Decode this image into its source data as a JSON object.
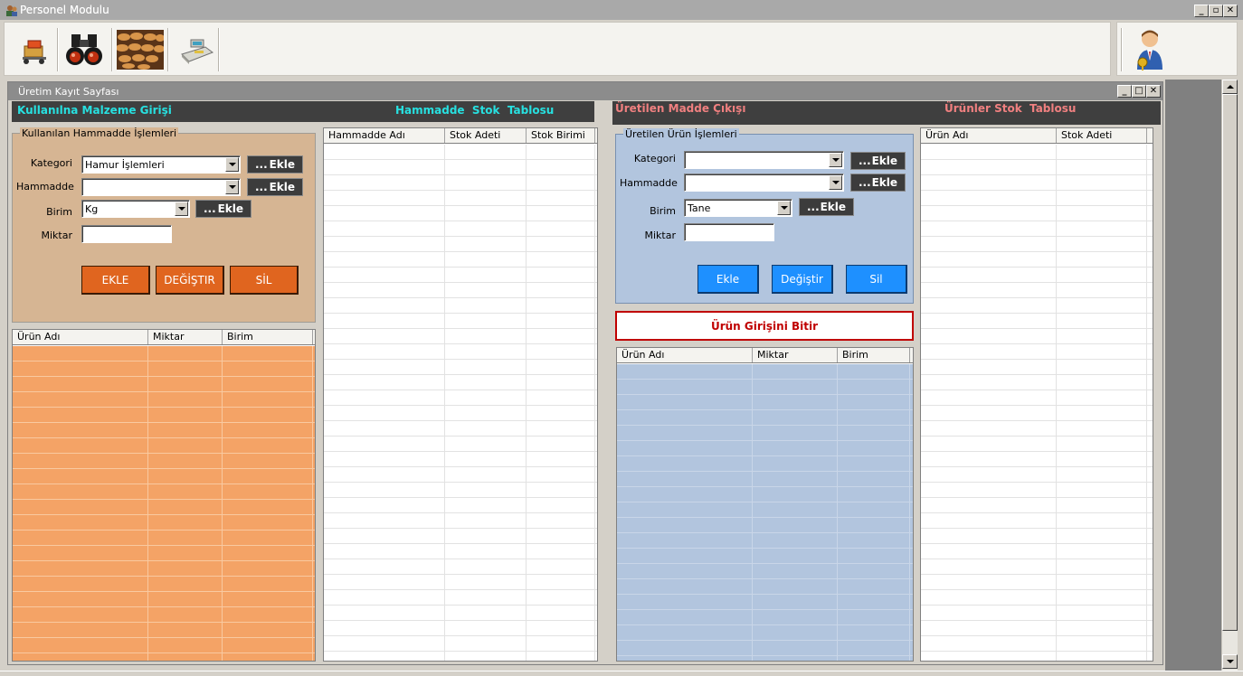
{
  "app": {
    "title": "Personel Modulu"
  },
  "toolbar": {
    "icons": [
      "box-delivery-icon",
      "binoculars-icon",
      "bread-photo-icon",
      "cash-register-icon",
      "user-keys-icon"
    ]
  },
  "inner": {
    "title": "Üretim Kayıt Sayfası"
  },
  "left": {
    "header_input": "Kullanılna Malzeme Girişi",
    "header_stock": "Hammadde  Stok  Tablosu",
    "group_title": "Kullanılan Hammadde  İşlemleri",
    "kategori_label": "Kategori",
    "kategori_value": "Hamur İşlemleri",
    "hammadde_label": "Hammadde",
    "hammadde_value": "",
    "birim_label": "Birim",
    "birim_value": "Kg",
    "miktar_label": "Miktar",
    "ekle_dots": "...",
    "ekle_label": "Ekle",
    "btn_add": "EKLE",
    "btn_change": "DEĞİŞTIR",
    "btn_delete": "SİL",
    "list_columns": [
      "Ürün Adı",
      "Miktar",
      "Birim"
    ],
    "stock_columns": [
      "Hammadde Adı",
      "Stok Adeti",
      "Stok Birimi"
    ]
  },
  "right": {
    "header_output": "Üretilen Madde Çıkışı",
    "header_stock": "Ürünler Stok  Tablosu",
    "group_title": "Üretilen Ürün İşlemleri",
    "kategori_label": "Kategori",
    "kategori_value": "",
    "hammadde_label": "Hammadde",
    "hammadde_value": "",
    "birim_label": "Birim",
    "birim_value": "Tane",
    "miktar_label": "Miktar",
    "ekle_dots": "...",
    "ekle_label": "Ekle",
    "btn_add": "Ekle",
    "btn_change": "Değiştir",
    "btn_delete": "Sil",
    "finish_button": "Ürün Girişini Bitir",
    "list_columns": [
      "Ürün Adı",
      "Miktar",
      "Birim"
    ],
    "stock_columns": [
      "Ürün Adı",
      "Stok Adeti"
    ]
  },
  "colors": {
    "accent_orange": "#e0651f",
    "accent_blue": "#1e90ff",
    "header_cyan": "#27e0e0",
    "header_salmon": "#f08080",
    "finish_border": "#c00000"
  }
}
